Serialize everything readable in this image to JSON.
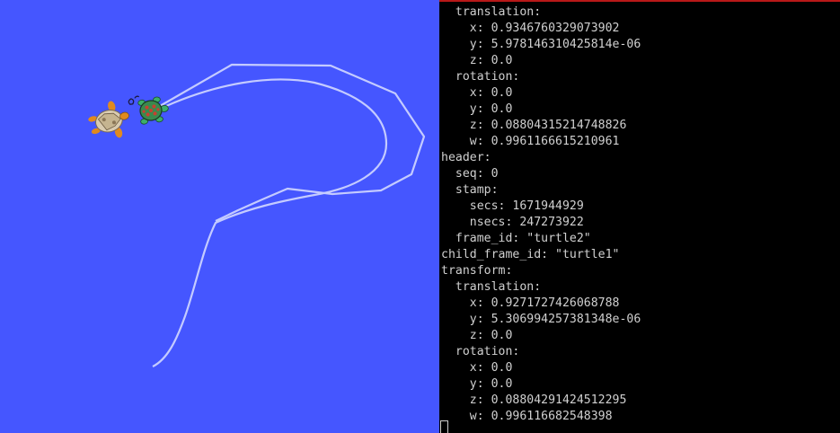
{
  "simulator": {
    "background": "#4556ff",
    "trail_color": "#c4cbff",
    "turtles": [
      {
        "name": "turtle1",
        "icon": "turtle-icon"
      },
      {
        "name": "turtle2",
        "icon": "turtle-icon"
      }
    ]
  },
  "terminal": {
    "background": "#000000",
    "text_color": "#d0d0d0",
    "lines": [
      "  translation:",
      "    x: 0.9346760329073902",
      "    y: 5.978146310425814e-06",
      "    z: 0.0",
      "  rotation:",
      "    x: 0.0",
      "    y: 0.0",
      "    z: 0.08804315214748826",
      "    w: 0.9961166615210961",
      "header:",
      "  seq: 0",
      "  stamp:",
      "    secs: 1671944929",
      "    nsecs: 247273922",
      "  frame_id: \"turtle2\"",
      "child_frame_id: \"turtle1\"",
      "transform:",
      "  translation:",
      "    x: 0.9271727426068788",
      "    y: 5.306994257381348e-06",
      "    z: 0.0",
      "  rotation:",
      "    x: 0.0",
      "    y: 0.0",
      "    z: 0.08804291424512295",
      "    w: 0.996116682548398"
    ]
  }
}
